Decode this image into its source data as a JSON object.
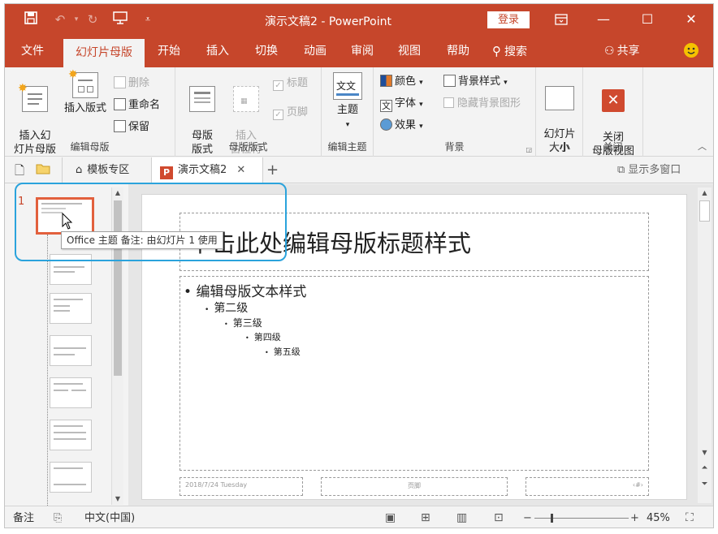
{
  "titlebar": {
    "title": "演示文稿2  -  PowerPoint",
    "login_label": "登录",
    "save_icon": "save-icon",
    "undo_icon": "undo-icon",
    "redo_icon": "redo-icon",
    "present_icon": "present-icon",
    "customize_icon": "customize-qat-icon"
  },
  "tabs": [
    {
      "label": "文件"
    },
    {
      "label": "幻灯片母版"
    },
    {
      "label": "开始"
    },
    {
      "label": "插入"
    },
    {
      "label": "切换"
    },
    {
      "label": "动画"
    },
    {
      "label": "审阅"
    },
    {
      "label": "视图"
    },
    {
      "label": "帮助"
    }
  ],
  "search_label": "搜索",
  "share_label": "共享",
  "ribbon": {
    "edit_master": {
      "insert_slide_master": "插入幻\n灯片母版",
      "insert_layout": "插入版式",
      "delete": "删除",
      "rename": "重命名",
      "preserve": "保留",
      "group": "编辑母版"
    },
    "master_layout": {
      "master_layout": "母版\n版式",
      "insert_placeholder": "插入\n占位符",
      "title": "标题",
      "footer": "页脚",
      "group": "母版版式"
    },
    "edit_theme": {
      "themes": "主题",
      "theme_sample": "文文",
      "group": "编辑主题"
    },
    "background": {
      "colors": "颜色",
      "fonts": "字体",
      "effects": "效果",
      "bg_styles": "背景样式",
      "hide_bg": "隐藏背景图形",
      "group": "背景"
    },
    "size": {
      "slide_size": "幻灯片\n大小",
      "group": "大小"
    },
    "close": {
      "close_master": "关闭\n母版视图",
      "group": "关闭"
    }
  },
  "doc_tabs": {
    "templates": "模板专区",
    "doc": "演示文稿2",
    "multi_window": "显示多窗口"
  },
  "thumbs": {
    "number": "1"
  },
  "tooltip": "Office 主题 备注: 由幻灯片 1 使用",
  "slide": {
    "title": "单击此处编辑母版标题样式",
    "levels": [
      "编辑母版文本样式",
      "第二级",
      "第三级",
      "第四级",
      "第五级"
    ],
    "footer_date": "2018/7/24 Tuesday",
    "footer_text": "页脚",
    "footer_num": "‹#›"
  },
  "status": {
    "notes": "备注",
    "language": "中文(中国)",
    "zoom": "45%"
  },
  "colors": {
    "accent": "#c6462b",
    "highlight": "#2ba3dc"
  }
}
